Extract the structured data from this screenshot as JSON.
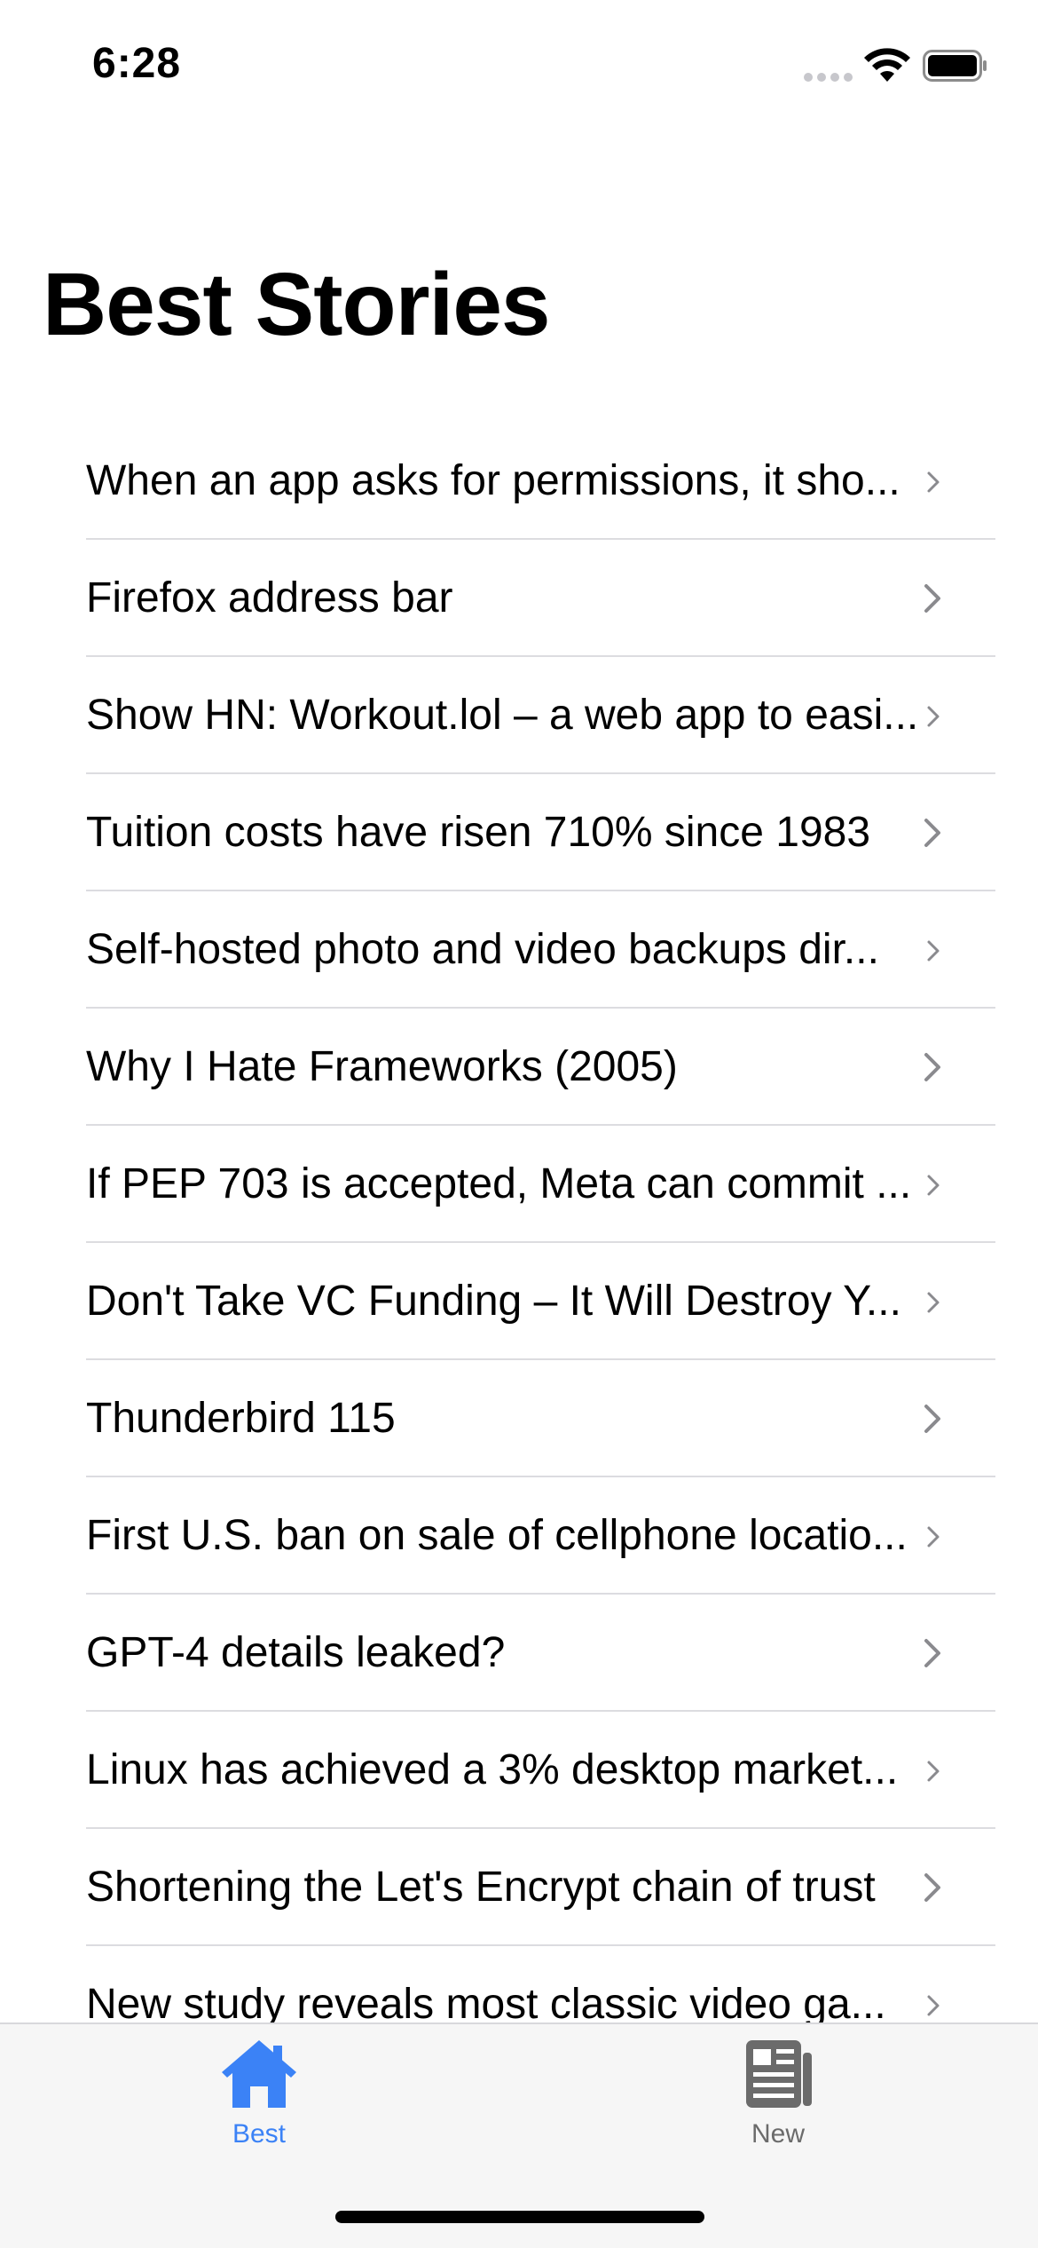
{
  "status_bar": {
    "time": "6:28",
    "icons": [
      "cellular-signal-icon",
      "wifi-icon",
      "battery-icon"
    ]
  },
  "header": {
    "title": "Best Stories"
  },
  "stories": [
    {
      "title": "When an app asks for permissions, it sho..."
    },
    {
      "title": "Firefox address bar"
    },
    {
      "title": "Show HN: Workout.lol – a web app to easi..."
    },
    {
      "title": "Tuition costs have risen 710% since 1983"
    },
    {
      "title": "Self-hosted photo and video backups dir..."
    },
    {
      "title": "Why I Hate Frameworks (2005)"
    },
    {
      "title": "If PEP 703 is accepted, Meta can commit ..."
    },
    {
      "title": "Don't Take VC Funding – It Will Destroy Y..."
    },
    {
      "title": "Thunderbird 115"
    },
    {
      "title": "First U.S. ban on sale of cellphone locatio..."
    },
    {
      "title": "GPT-4 details leaked?"
    },
    {
      "title": "Linux has achieved a 3% desktop market..."
    },
    {
      "title": "Shortening the Let's Encrypt chain of trust"
    },
    {
      "title": "New study reveals most classic video ga..."
    }
  ],
  "tab_bar": {
    "tabs": [
      {
        "label": "Best",
        "icon": "house-icon",
        "selected": true
      },
      {
        "label": "New",
        "icon": "newspaper-icon",
        "selected": false
      }
    ]
  },
  "colors": {
    "accent": "#3b82f6",
    "inactive_tab": "#6b6b6b",
    "chevron": "#8a8a8e",
    "separator": "#dcdce0",
    "tab_bar_background": "#f6f6f6"
  }
}
